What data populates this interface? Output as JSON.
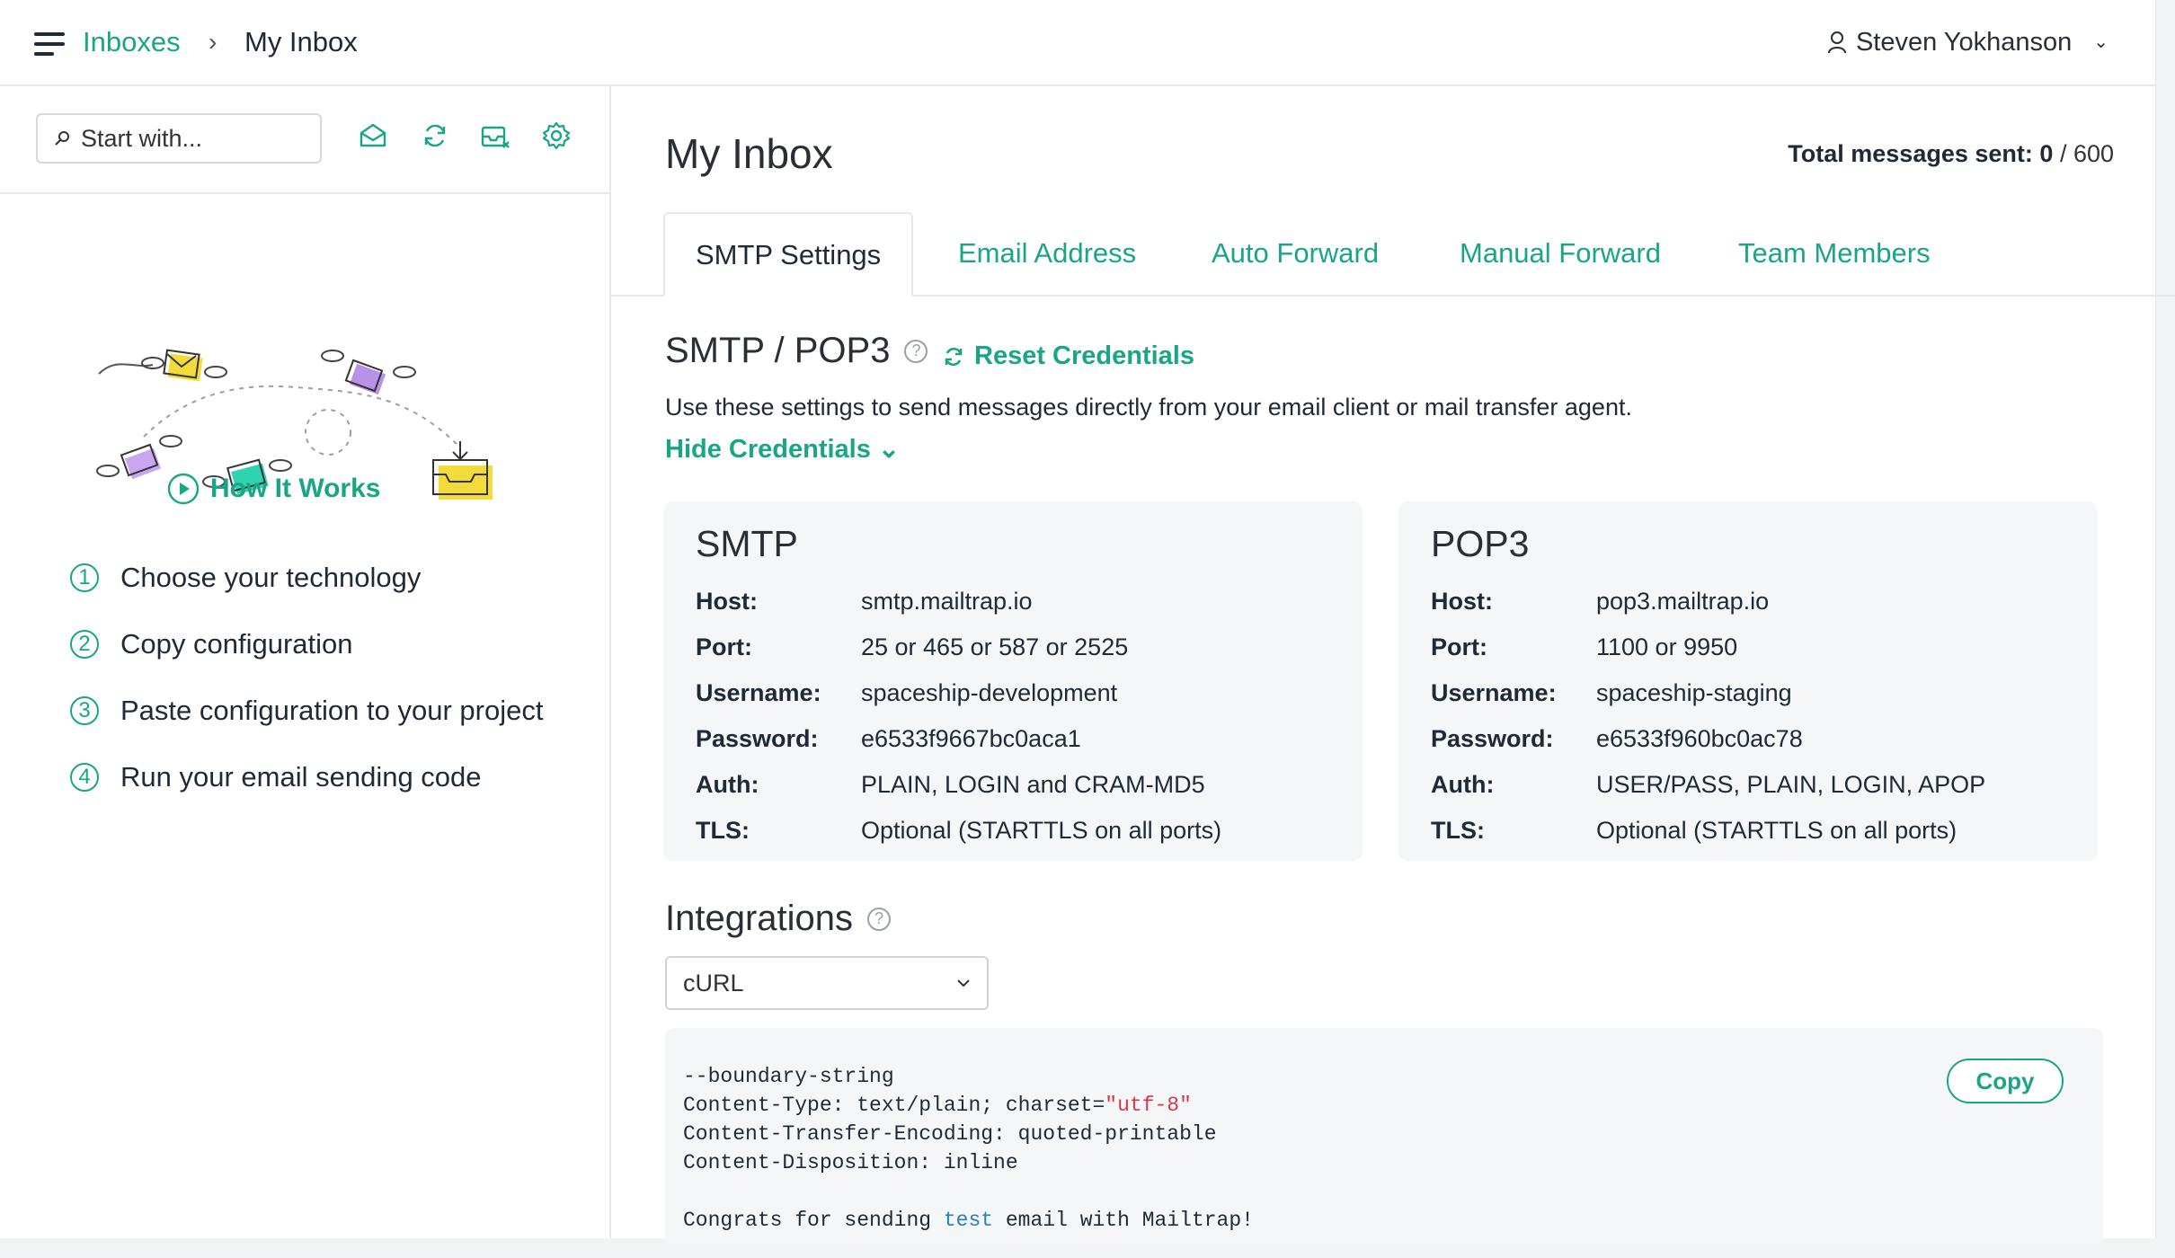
{
  "breadcrumb": {
    "root": "Inboxes",
    "separator": "›",
    "current": "My Inbox"
  },
  "user": {
    "name": "Steven Yokhanson",
    "chevron": "⌄"
  },
  "sidebar": {
    "search_placeholder": "Start with...",
    "tool_icons": [
      "envelope-open-icon",
      "refresh-icon",
      "clear-inbox-icon",
      "settings-icon"
    ],
    "how_it_works": "How It Works",
    "steps": [
      {
        "num": "1",
        "label": "Choose your technology"
      },
      {
        "num": "2",
        "label": "Copy configuration"
      },
      {
        "num": "3",
        "label": "Paste configuration to your project"
      },
      {
        "num": "4",
        "label": "Run your email sending code"
      }
    ]
  },
  "main": {
    "title": "My Inbox",
    "total_label": "Total messages sent:",
    "total_sent": "0",
    "total_limit": "/ 600",
    "tabs": [
      "SMTP Settings",
      "Email Address",
      "Auto Forward",
      "Manual Forward",
      "Team Members"
    ],
    "section_title": "SMTP / POP3",
    "help_glyph": "?",
    "reset_label": "Reset Credentials",
    "description": "Use these settings to send messages directly from your email client or mail transfer agent.",
    "hide_credentials": "Hide Credentials ⌄",
    "smtp": {
      "title": "SMTP",
      "rows": [
        {
          "k": "Host:",
          "v": "smtp.mailtrap.io"
        },
        {
          "k": "Port:",
          "v": "25 or 465 or 587 or 2525"
        },
        {
          "k": "Username:",
          "v": "spaceship-development"
        },
        {
          "k": "Password:",
          "v": "e6533f9667bc0aca1"
        },
        {
          "k": "Auth:",
          "v": "PLAIN, LOGIN and CRAM-MD5"
        },
        {
          "k": "TLS:",
          "v": "Optional (STARTTLS on all ports)"
        }
      ]
    },
    "pop3": {
      "title": "POP3",
      "rows": [
        {
          "k": "Host:",
          "v": "pop3.mailtrap.io"
        },
        {
          "k": "Port:",
          "v": "1100 or 9950"
        },
        {
          "k": "Username:",
          "v": "spaceship-staging"
        },
        {
          "k": "Password:",
          "v": "e6533f960bc0ac78"
        },
        {
          "k": "Auth:",
          "v": "USER/PASS, PLAIN, LOGIN, APOP"
        },
        {
          "k": "TLS:",
          "v": "Optional (STARTTLS on all ports)"
        }
      ]
    },
    "integrations_title": "Integrations",
    "integration_selected": "cURL",
    "copy_label": "Copy",
    "code": {
      "line1": "--boundary-string",
      "line2_a": "Content-Type: text/plain; charset=",
      "line2_str": "\"utf-8\"",
      "line3": "Content-Transfer-Encoding: quoted-printable",
      "line4": "Content-Disposition: inline",
      "line6_a": "Congrats for sending ",
      "line6_kw": "test",
      "line6_b": " email with Mailtrap!"
    }
  },
  "colors": {
    "accent": "#1aa587",
    "text": "#1f2a36",
    "card_bg": "#f5f6f7",
    "code_string": "#d63a4a",
    "code_keyword": "#2b7fbf"
  }
}
